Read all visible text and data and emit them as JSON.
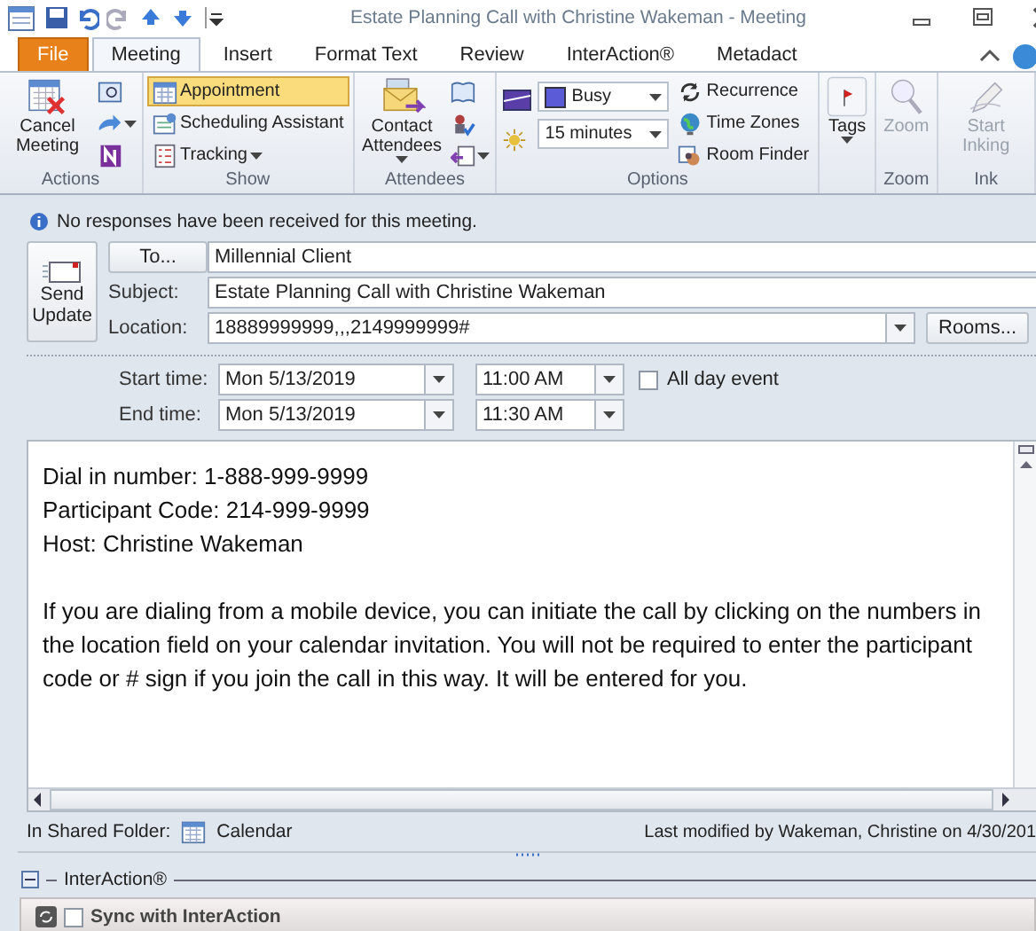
{
  "window": {
    "title": "Estate Planning Call with Christine Wakeman  -  Meeting"
  },
  "tabs": [
    {
      "label": "File",
      "kind": "file",
      "selected": false
    },
    {
      "label": "Meeting",
      "kind": "tab",
      "selected": true
    },
    {
      "label": "Insert",
      "kind": "tab",
      "selected": false
    },
    {
      "label": "Format Text",
      "kind": "tab",
      "selected": false
    },
    {
      "label": "Review",
      "kind": "tab",
      "selected": false
    },
    {
      "label": "InterAction®",
      "kind": "tab",
      "selected": false
    },
    {
      "label": "Metadact",
      "kind": "tab",
      "selected": false
    }
  ],
  "ribbon": {
    "groups": [
      {
        "label": "Actions",
        "columns": [
          [
            {
              "kind": "large",
              "label": "Cancel Meeting",
              "menu": false,
              "disabled": false
            }
          ],
          [
            {
              "kind": "icon",
              "menu": false
            },
            {
              "kind": "icon",
              "menu": true
            },
            {
              "kind": "icon",
              "menu": false
            }
          ]
        ]
      },
      {
        "label": "Show",
        "columns": [
          [
            {
              "kind": "small",
              "label": "Appointment",
              "menu": false,
              "selected": true
            },
            {
              "kind": "small",
              "label": "Scheduling Assistant",
              "menu": false,
              "selected": false
            },
            {
              "kind": "small",
              "label": "Tracking",
              "menu": true,
              "selected": false
            }
          ]
        ]
      },
      {
        "label": "Attendees",
        "columns": [
          [
            {
              "kind": "large",
              "label": "Contact Attendees",
              "menu": true,
              "disabled": false
            }
          ],
          [
            {
              "kind": "icon",
              "menu": false
            },
            {
              "kind": "icon",
              "menu": false
            },
            {
              "kind": "icon",
              "menu": true
            }
          ]
        ]
      },
      {
        "label": "Options",
        "columns": [
          [
            {
              "kind": "icon",
              "menu": false
            },
            {
              "kind": "icon",
              "menu": false
            }
          ],
          [
            {
              "kind": "combo",
              "value": "Busy"
            },
            {
              "kind": "combo",
              "value": "15 minutes"
            }
          ],
          [
            {
              "kind": "small",
              "label": "Recurrence",
              "menu": false,
              "selected": false
            },
            {
              "kind": "small",
              "label": "Time Zones",
              "menu": false,
              "selected": false
            },
            {
              "kind": "small",
              "label": "Room Finder",
              "menu": false,
              "selected": false
            }
          ]
        ]
      },
      {
        "columns": [
          [
            {
              "kind": "large",
              "label": "Tags",
              "menu": true,
              "disabled": false
            }
          ]
        ]
      },
      {
        "label": "Zoom",
        "columns": [
          [
            {
              "kind": "large",
              "label": "Zoom",
              "menu": false,
              "disabled": true
            }
          ]
        ]
      },
      {
        "label": "Ink",
        "columns": [
          [
            {
              "kind": "large",
              "label": "Start Inking",
              "menu": false,
              "disabled": true
            }
          ]
        ]
      }
    ]
  },
  "info": "No responses have been received for this meeting.",
  "form": {
    "send_button": "Send Update",
    "to_button": "To...",
    "to": "Millennial Client",
    "subject_label": "Subject:",
    "subject": "Estate Planning Call with Christine Wakeman",
    "location_label": "Location:",
    "location": "18889999999,,,2149999999#",
    "rooms_button": "Rooms...",
    "start_label": "Start time:",
    "start_date": "Mon 5/13/2019",
    "start_time": "11:00 AM",
    "all_day": {
      "label": "All day event",
      "checked": false
    },
    "end_label": "End time:",
    "end_date": "Mon 5/13/2019",
    "end_time": "11:30 AM"
  },
  "body": [
    "Dial in number:  1-888-999-9999",
    "Participant Code:  214-999-9999",
    "Host:  Christine Wakeman",
    "If you are dialing from a mobile device, you can initiate the call by clicking on the numbers in the location field on your calendar invitation.  You will not be required to enter the participant code or # sign if you join the call in this way. It will be entered for you."
  ],
  "status_bar": {
    "folder_label": "In Shared Folder:",
    "folder": "Calendar",
    "modified": "Last modified by Wakeman, Christine on 4/30/201"
  },
  "interaction": {
    "title": "InterAction®",
    "expanded": true,
    "sync": {
      "label": "Sync with InterAction",
      "checked": false
    }
  }
}
